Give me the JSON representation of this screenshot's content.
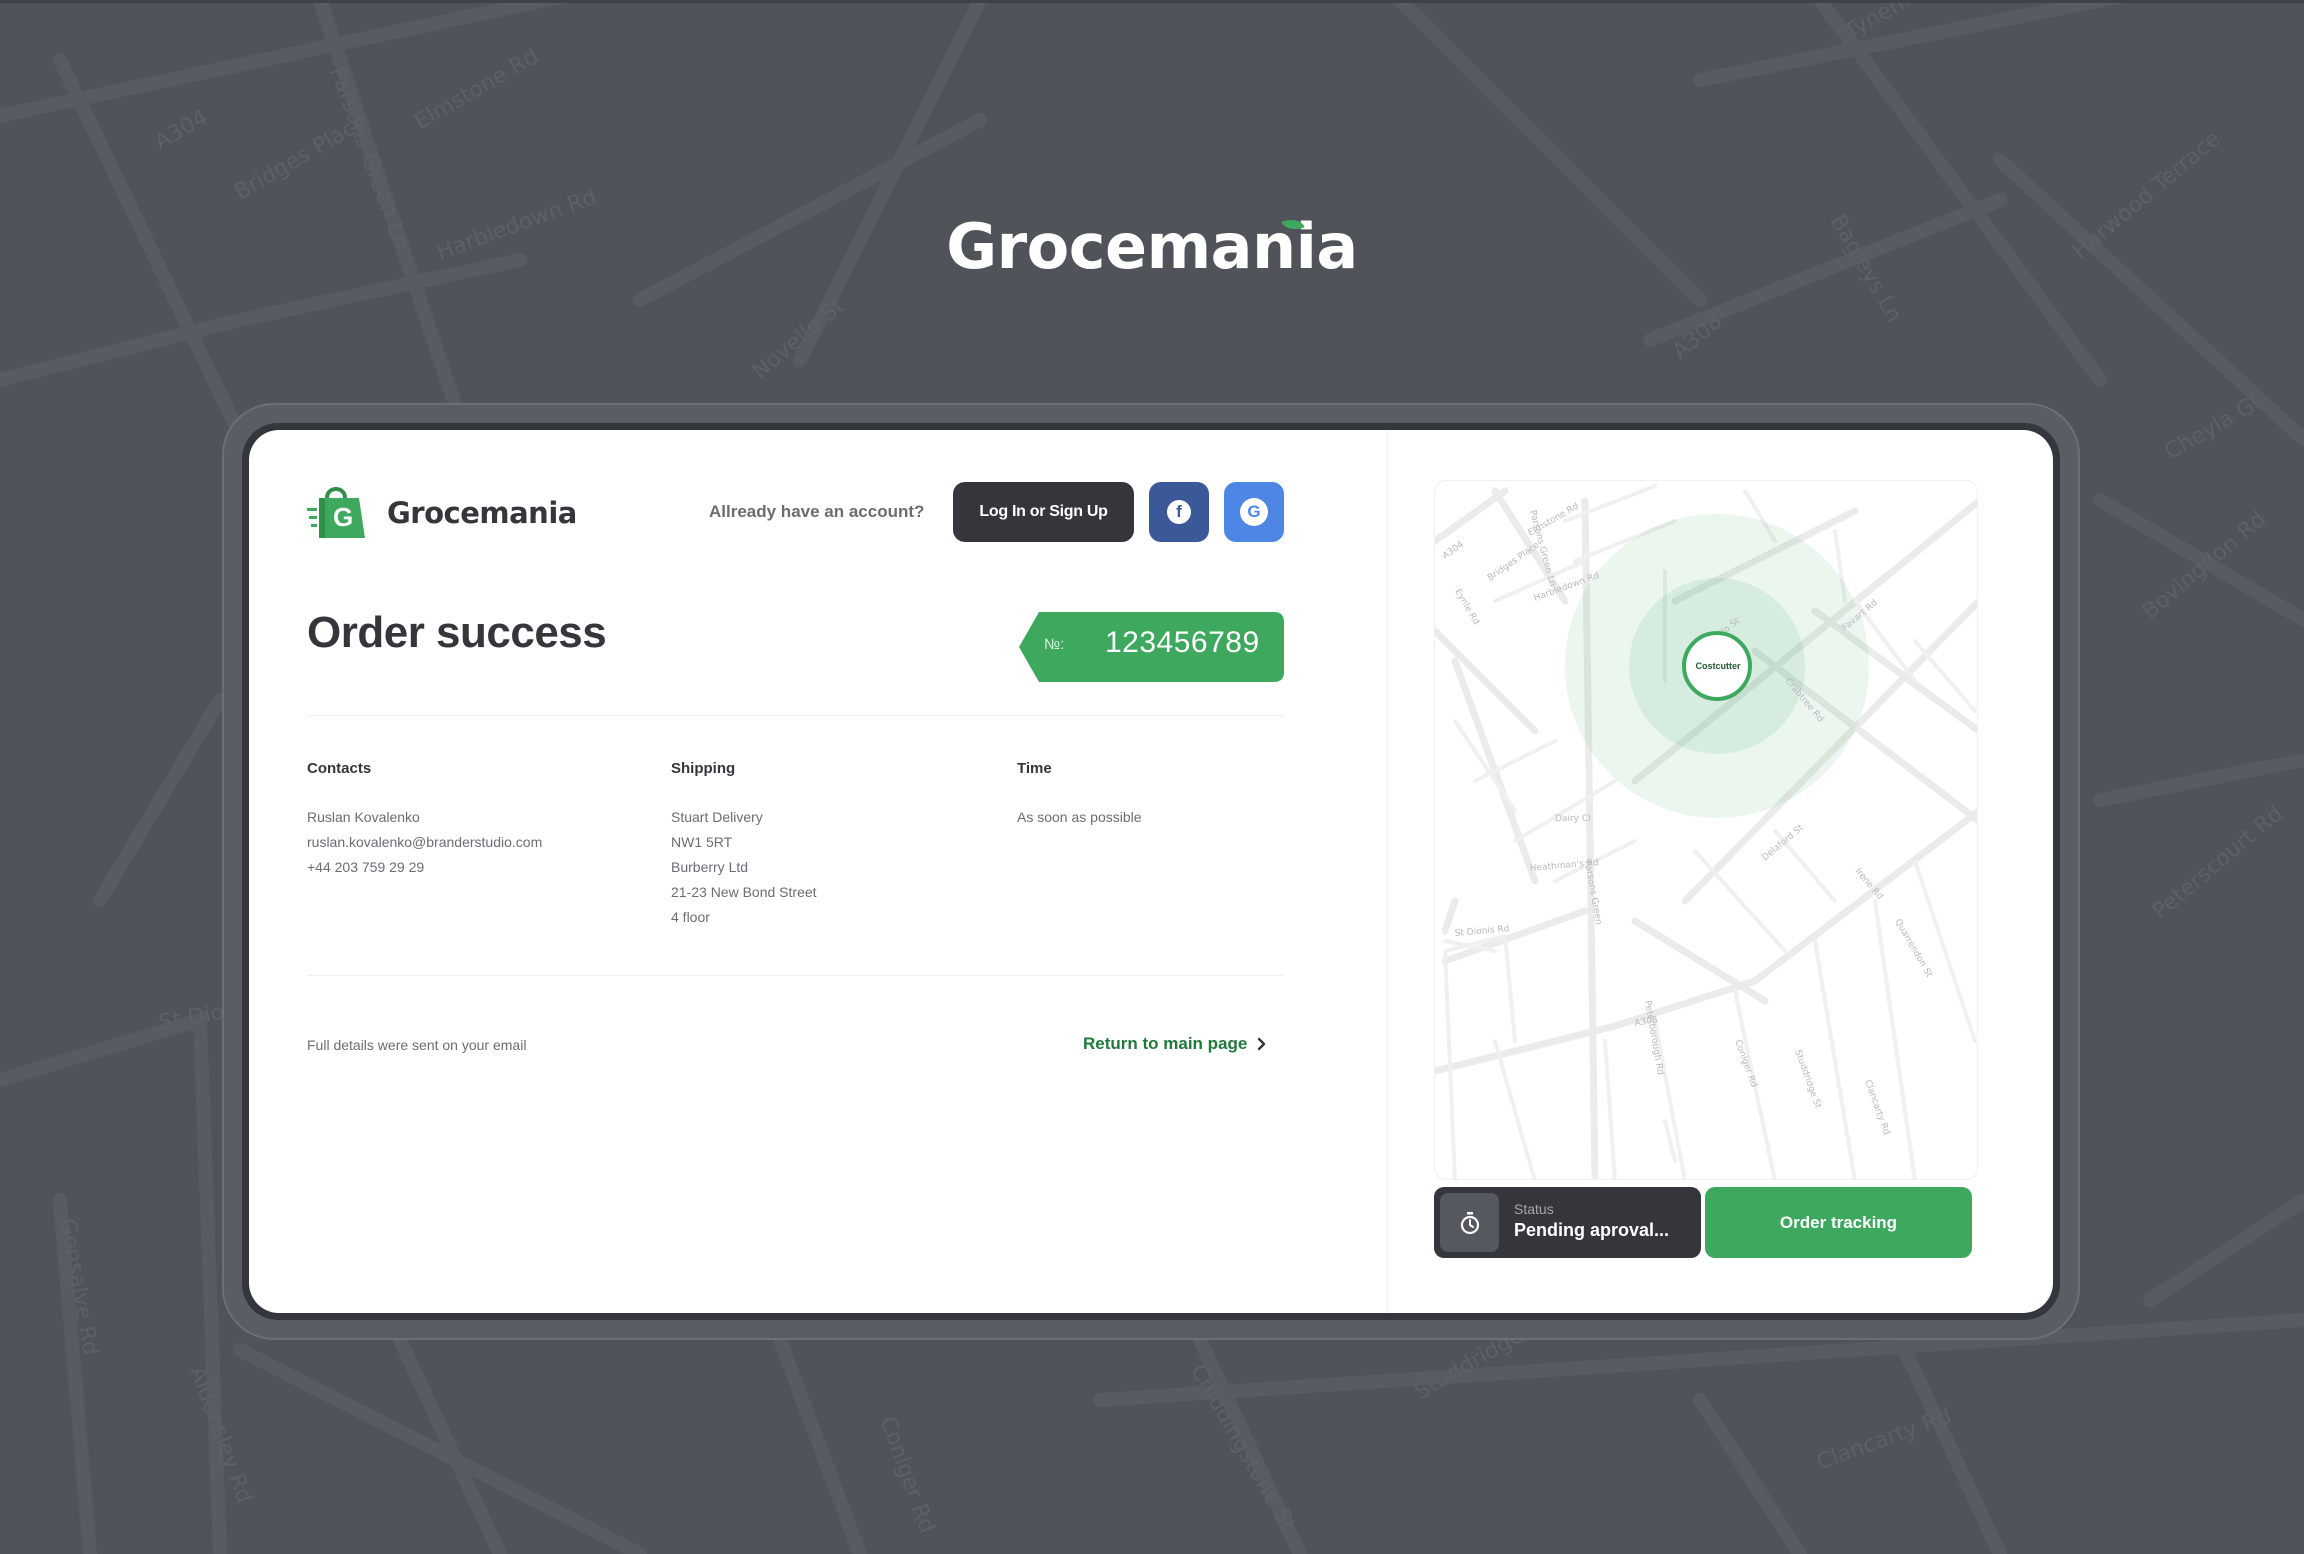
{
  "brand": {
    "name": "Grocemania"
  },
  "header": {
    "logo_text": "Grocemania",
    "logo_letter": "G",
    "account_question": "Allready have an account?",
    "login_label": "Log In or Sign Up",
    "facebook_letter": "f",
    "google_letter": "G"
  },
  "order": {
    "title": "Order success",
    "number_prefix": "№:",
    "number": "123456789"
  },
  "contacts": {
    "heading": "Contacts",
    "name": "Ruslan Kovalenko",
    "email": "ruslan.kovalenko@branderstudio.com",
    "phone": "+44 203 759 29 29"
  },
  "shipping": {
    "heading": "Shipping",
    "lines": [
      "Stuart Delivery",
      "NW1 5RT",
      "Burberry Ltd",
      "21-23 New Bond Street",
      "4 floor"
    ]
  },
  "time": {
    "heading": "Time",
    "value": "As soon as possible"
  },
  "footer": {
    "email_note": "Full details were sent on your email",
    "return_label": "Return to main page"
  },
  "map": {
    "store_label": "Costcutter",
    "streets": [
      "A304",
      "Bridges Place",
      "Elmstone Rd",
      "Harbledown Rd",
      "Parsons Green Ln",
      "Eynle Rd",
      "Novello St",
      "Favart Rd",
      "Crabtree Rd",
      "Peterborough Rd",
      "A308",
      "St Dionis Rd",
      "Heathman's Rd",
      "Dairy Cl",
      "Parsons Green",
      "Studdridge St",
      "Coniger Rd",
      "Clancarty Rd",
      "Quarrendon St",
      "Delaford St",
      "Irene Rd"
    ]
  },
  "status": {
    "label": "Status",
    "value": "Pending aproval..."
  },
  "tracking": {
    "label": "Order tracking"
  },
  "colors": {
    "accent": "#3fa85f",
    "dark": "#34363b",
    "facebook": "#3b5998",
    "google": "#4e86e6",
    "background": "#50535a"
  }
}
